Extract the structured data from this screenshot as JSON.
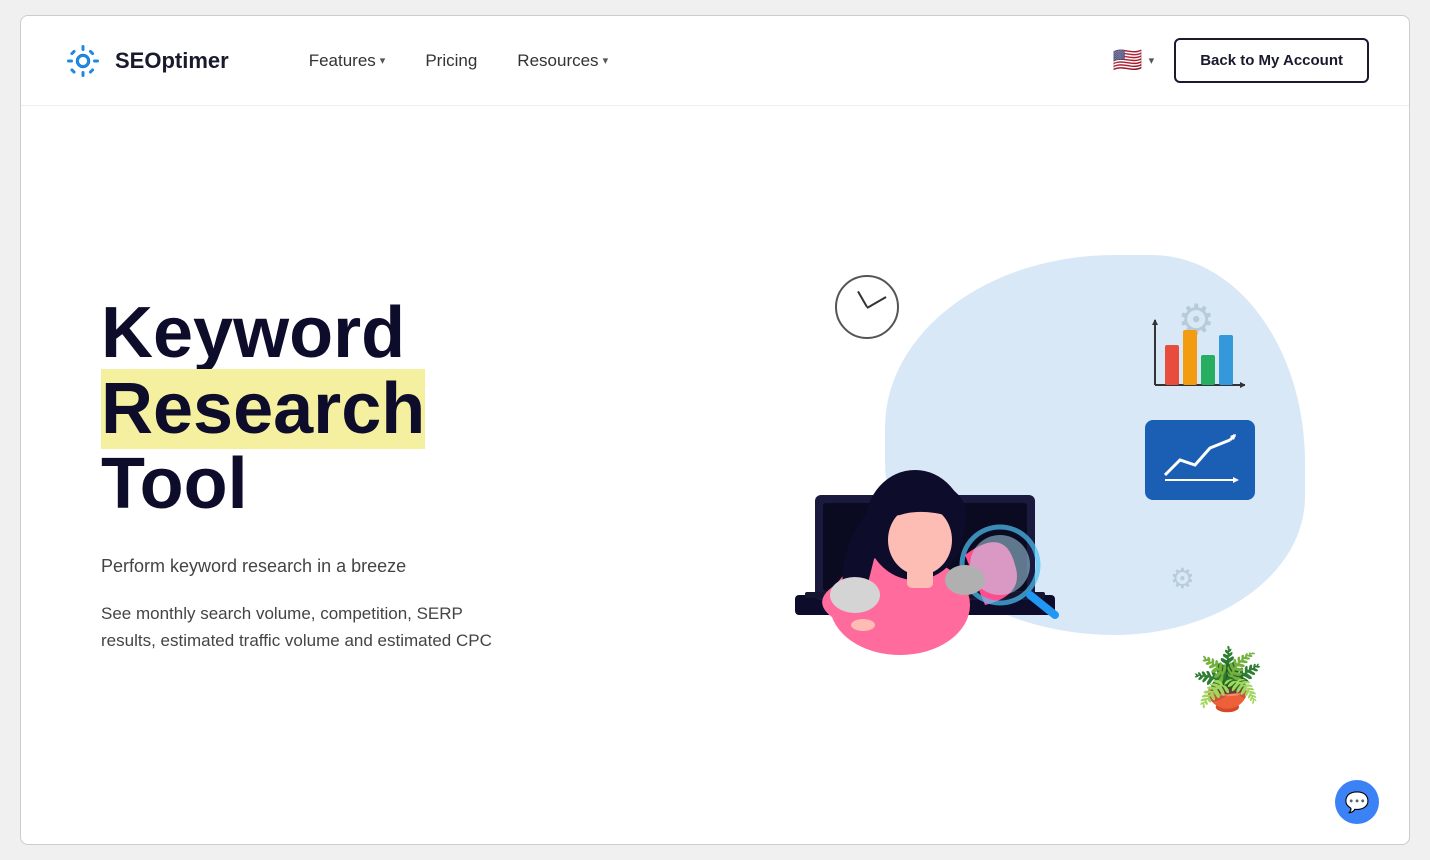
{
  "brand": {
    "name": "SEOptimer",
    "logo_alt": "SEOptimer logo"
  },
  "nav": {
    "features_label": "Features",
    "pricing_label": "Pricing",
    "resources_label": "Resources",
    "back_button_label": "Back to My Account",
    "language": "EN",
    "flag_emoji": "🇺🇸"
  },
  "hero": {
    "title_line1": "Keyword",
    "title_line2": "Research",
    "title_line3": "Tool",
    "subtitle": "Perform keyword research in a breeze",
    "description": "See monthly search volume, competition, SERP results, estimated traffic volume and estimated CPC"
  },
  "chat": {
    "icon": "💬"
  }
}
